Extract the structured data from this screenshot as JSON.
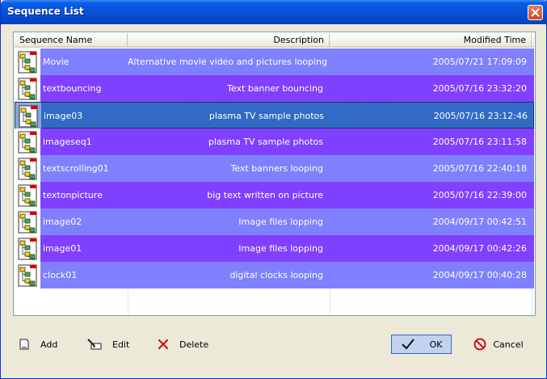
{
  "window": {
    "title": "Sequence List"
  },
  "columns": {
    "name": "Sequence Name",
    "description": "Description",
    "modified": "Modified Time"
  },
  "rows": [
    {
      "name": "Movie",
      "description": "Alternative movie video and pictures looping",
      "modified": "2005/07/21 17:09:09"
    },
    {
      "name": "textbouncing",
      "description": "Text banner bouncing",
      "modified": "2005/07/16 23:32:20"
    },
    {
      "name": "image03",
      "description": "plasma TV sample photos",
      "modified": "2005/07/16 23:12:46"
    },
    {
      "name": "imageseq1",
      "description": "plasma TV sample photos",
      "modified": "2005/07/16 23:11:58"
    },
    {
      "name": "textscrolling01",
      "description": "Text banners looping",
      "modified": "2005/07/16 22:40:18"
    },
    {
      "name": "textonpicture",
      "description": "big text written on picture",
      "modified": "2005/07/16 22:39:00"
    },
    {
      "name": "image02",
      "description": "Image files lopping",
      "modified": "2004/09/17 00:42:51"
    },
    {
      "name": "image01",
      "description": "Image files lopping",
      "modified": "2004/09/17 00:42:26"
    },
    {
      "name": "clock01",
      "description": "digital clocks looping",
      "modified": "2004/09/17 00:40:28"
    }
  ],
  "selected_row": "image03",
  "row_colors": {
    "light": "#8080ff",
    "dark": "#8040ff",
    "selected": "#316ac5"
  },
  "buttons": {
    "add": "Add",
    "edit": "Edit",
    "delete": "Delete",
    "ok": "OK",
    "cancel": "Cancel"
  },
  "icons": {
    "row": "sequence-tree-icon",
    "add": "new-document-icon",
    "edit": "edit-icon",
    "delete": "delete-x-icon",
    "ok": "checkmark-icon",
    "cancel": "no-entry-icon"
  }
}
